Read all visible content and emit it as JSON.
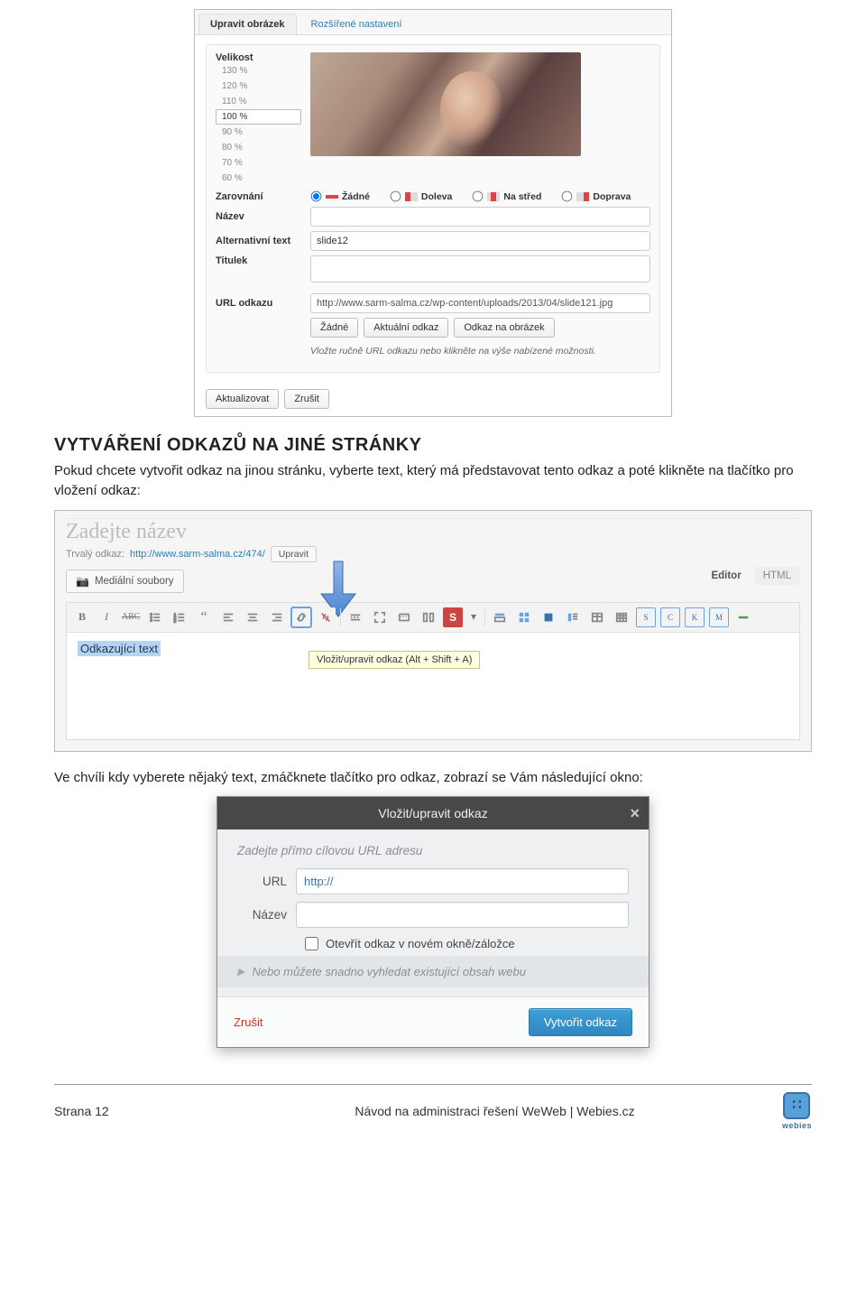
{
  "shot1": {
    "tabs": {
      "active": "Upravit obrázek",
      "inactive": "Rozšířené nastavení"
    },
    "size_label": "Velikost",
    "sizes": [
      "130 %",
      "120 %",
      "110 %",
      "100 %",
      "90 %",
      "80 %",
      "70 %",
      "60 %"
    ],
    "size_selected": "100 %",
    "align_label": "Zarovnání",
    "align_options": {
      "none": "Žádné",
      "left": "Doleva",
      "center": "Na střed",
      "right": "Doprava"
    },
    "name_label": "Název",
    "alt_label": "Alternativní text",
    "alt_value": "slide12",
    "caption_label": "Titulek",
    "url_label": "URL odkazu",
    "url_value": "http://www.sarm-salma.cz/wp-content/uploads/2013/04/slide121.jpg",
    "url_buttons": {
      "none": "Žádné",
      "current": "Aktuální odkaz",
      "image": "Odkaz na obrázek"
    },
    "url_hint": "Vložte ručně URL odkazu nebo klikněte na výše nabízené možnosti.",
    "footer": {
      "save": "Aktualizovat",
      "cancel": "Zrušit"
    }
  },
  "section": {
    "heading": "VYTVÁŘENÍ ODKAZŮ NA JINÉ STRÁNKY",
    "para1": "Pokud chcete vytvořit odkaz na jinou stránku, vyberte text, který má představovat tento odkaz a poté klikněte na tlačítko pro vložení odkaz:"
  },
  "shot2": {
    "title_placeholder": "Zadejte název",
    "permalink_label": "Trvalý odkaz:",
    "permalink_url": "http://www.sarm-salma.cz/474/",
    "permalink_edit": "Upravit",
    "media_button": "Mediální soubory",
    "tabs": {
      "visual": "Editor",
      "text": "HTML"
    },
    "selected_text": "Odkazující text",
    "tooltip": "Vložit/upravit odkaz (Alt + Shift + A)"
  },
  "para2": "Ve chvíli kdy vyberete nějaký text, zmáčknete tlačítko pro odkaz, zobrazí se Vám následující okno:",
  "shot3": {
    "title": "Vložit/upravit odkaz",
    "instruction": "Zadejte přímo cílovou URL adresu",
    "url_label": "URL",
    "url_value": "http://",
    "name_label": "Název",
    "checkbox": "Otevřít odkaz v novém okně/záložce",
    "search_hint": "Nebo můžete snadno vyhledat existující obsah webu",
    "cancel": "Zrušit",
    "submit": "Vytvořit odkaz"
  },
  "footer": {
    "page": "Strana 12",
    "title": "Návod na administraci řešení WeWeb | Webies.cz",
    "brand": "webies"
  }
}
